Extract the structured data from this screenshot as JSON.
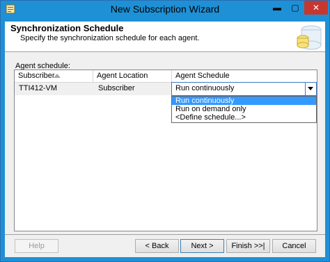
{
  "window": {
    "title": "New Subscription Wizard",
    "minimize_glyph": "▬",
    "maximize_glyph": "▢",
    "close_glyph": "✕",
    "accent_color": "#1e90d6",
    "close_color": "#c7372f"
  },
  "header": {
    "title": "Synchronization Schedule",
    "subtitle": "Specify the synchronization schedule for each agent.",
    "graphic_icon": "database-sync-icon"
  },
  "agent_schedule": {
    "label": "Agent schedule:",
    "columns": [
      "Subscriber",
      "Agent Location",
      "Agent Schedule"
    ],
    "sort_column": "Subscriber",
    "rows": [
      {
        "subscriber": "TTI412-VM",
        "agent_location": "Subscriber",
        "agent_schedule": "Run continuously"
      }
    ],
    "dropdown_options": [
      "Run continuously",
      "Run on demand only",
      "<Define schedule...>"
    ],
    "dropdown_selected": "Run continuously",
    "highlight_color": "#3399ff"
  },
  "footer": {
    "help": "Help",
    "back": "< Back",
    "next": "Next >",
    "finish": "Finish >>|",
    "cancel": "Cancel"
  }
}
